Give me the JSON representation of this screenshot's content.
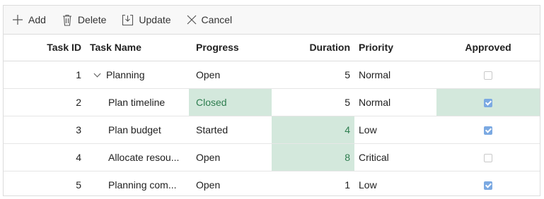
{
  "toolbar": {
    "add_label": "Add",
    "delete_label": "Delete",
    "update_label": "Update",
    "cancel_label": "Cancel"
  },
  "columns": {
    "task_id": "Task ID",
    "task_name": "Task Name",
    "progress": "Progress",
    "duration": "Duration",
    "priority": "Priority",
    "approved": "Approved"
  },
  "rows": [
    {
      "task_id": "1",
      "task_name": "Planning",
      "progress": "Open",
      "duration": "5",
      "priority": "Normal",
      "approved": false
    },
    {
      "task_id": "2",
      "task_name": "Plan timeline",
      "progress": "Closed",
      "duration": "5",
      "priority": "Normal",
      "approved": true
    },
    {
      "task_id": "3",
      "task_name": "Plan budget",
      "progress": "Started",
      "duration": "4",
      "priority": "Low",
      "approved": true
    },
    {
      "task_id": "4",
      "task_name": "Allocate resou...",
      "progress": "Open",
      "duration": "8",
      "priority": "Critical",
      "approved": false
    },
    {
      "task_id": "5",
      "task_name": "Planning com...",
      "progress": "Open",
      "duration": "1",
      "priority": "Low",
      "approved": true
    }
  ],
  "colors": {
    "edited_cell_bg": "#d3e8dc",
    "edited_cell_text": "#2e7d4f",
    "checkbox_checked": "#7ba9e2"
  }
}
